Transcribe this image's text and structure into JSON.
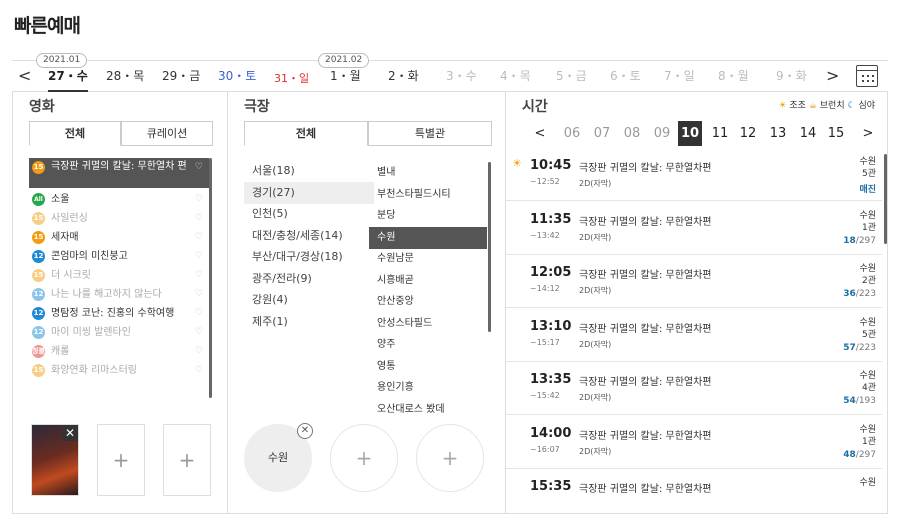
{
  "page_title": "빠른예매",
  "date_bar": {
    "prev": "<",
    "next": ">",
    "month_tags": [
      "2021.01",
      "2021.02"
    ],
    "dates": [
      {
        "label": "27・수",
        "kind": "sel"
      },
      {
        "label": "28・목",
        "kind": ""
      },
      {
        "label": "29・금",
        "kind": ""
      },
      {
        "label": "30・토",
        "kind": "sat"
      },
      {
        "label": "31・일",
        "kind": "sun"
      },
      {
        "label": "1・월",
        "kind": ""
      },
      {
        "label": "2・화",
        "kind": ""
      },
      {
        "label": "3・수",
        "kind": "dim"
      },
      {
        "label": "4・목",
        "kind": "dim"
      },
      {
        "label": "5・금",
        "kind": "dim"
      },
      {
        "label": "6・토",
        "kind": "dim"
      },
      {
        "label": "7・일",
        "kind": "dim"
      },
      {
        "label": "8・월",
        "kind": "dim"
      },
      {
        "label": "9・화",
        "kind": "dim"
      }
    ],
    "calendar_icon": "calendar-icon"
  },
  "movie": {
    "heading": "영화",
    "tabs": [
      "전체",
      "큐레이션"
    ],
    "items": [
      {
        "rating": "15",
        "title": "극장판 귀멸의 칼날: 무한열차 편",
        "state": "sel"
      },
      {
        "rating": "All",
        "title": "소울",
        "state": ""
      },
      {
        "rating": "15",
        "title": "사일런싱",
        "state": "dim"
      },
      {
        "rating": "15",
        "title": "세자매",
        "state": ""
      },
      {
        "rating": "12",
        "title": "콘엄마의 미친붕고",
        "state": ""
      },
      {
        "rating": "15",
        "title": "더 시크릿",
        "state": "dim"
      },
      {
        "rating": "12",
        "title": "나는 나를 해고하지 않는다",
        "state": "dim"
      },
      {
        "rating": "12",
        "title": "명탐정 코난: 진홍의 수학여행",
        "state": ""
      },
      {
        "rating": "12",
        "title": "마이 미씽 발렌타인",
        "state": "dim"
      },
      {
        "rating": "청불",
        "title": "캐롤",
        "state": "dim"
      },
      {
        "rating": "15",
        "title": "화양연화 리마스터링",
        "state": "dim"
      }
    ],
    "rating_colors": {
      "15": "#f39c12",
      "All": "#27a74a",
      "12": "#1e8ad6",
      "청불": "#e0302c"
    },
    "plus": "+",
    "close": "✕"
  },
  "theater": {
    "heading": "극장",
    "tabs": [
      "전체",
      "특별관"
    ],
    "regions": [
      "서울(18)",
      "경기(27)",
      "인천(5)",
      "대전/충청/세종(14)",
      "부산/대구/경상(18)",
      "광주/전라(9)",
      "강원(4)",
      "제주(1)"
    ],
    "branches": [
      "별내",
      "부천스타필드시티",
      "분당",
      "수원",
      "수원남문",
      "시흥배곧",
      "안산중앙",
      "안성스타필드",
      "양주",
      "영통",
      "용인기흥",
      "오산대로스 봤데"
    ],
    "selected_branch": "수원",
    "plus": "+",
    "close": "✕"
  },
  "time": {
    "heading": "시간",
    "legend": {
      "morning": "조조",
      "brunch": "브런치",
      "night": "심야"
    },
    "hours": [
      "<",
      "06",
      "07",
      "08",
      "09",
      "10",
      "11",
      "12",
      "13",
      "14",
      "15",
      ">"
    ],
    "sessions": [
      {
        "start": "10:45",
        "end": "~12:52",
        "title": "극장판 귀멸의 칼날: 무한열차편",
        "format": "2D(자막)",
        "branch": "수원",
        "hall": "5관",
        "seats": "",
        "total": "매진",
        "morning": true
      },
      {
        "start": "11:35",
        "end": "~13:42",
        "title": "극장판 귀멸의 칼날: 무한열차편",
        "format": "2D(자막)",
        "branch": "수원",
        "hall": "1관",
        "seats": "18",
        "total": "/297",
        "morning": false
      },
      {
        "start": "12:05",
        "end": "~14:12",
        "title": "극장판 귀멸의 칼날: 무한열차편",
        "format": "2D(자막)",
        "branch": "수원",
        "hall": "2관",
        "seats": "36",
        "total": "/223",
        "morning": false
      },
      {
        "start": "13:10",
        "end": "~15:17",
        "title": "극장판 귀멸의 칼날: 무한열차편",
        "format": "2D(자막)",
        "branch": "수원",
        "hall": "5관",
        "seats": "57",
        "total": "/223",
        "morning": false
      },
      {
        "start": "13:35",
        "end": "~15:42",
        "title": "극장판 귀멸의 칼날: 무한열차편",
        "format": "2D(자막)",
        "branch": "수원",
        "hall": "4관",
        "seats": "54",
        "total": "/193",
        "morning": false
      },
      {
        "start": "14:00",
        "end": "~16:07",
        "title": "극장판 귀멸의 칼날: 무한열차편",
        "format": "2D(자막)",
        "branch": "수원",
        "hall": "1관",
        "seats": "48",
        "total": "/297",
        "morning": false
      },
      {
        "start": "15:35",
        "end": "",
        "title": "극장판 귀멸의 칼날: 무한열차편",
        "format": "",
        "branch": "수원",
        "hall": "",
        "seats": "",
        "total": "",
        "morning": false
      }
    ]
  }
}
